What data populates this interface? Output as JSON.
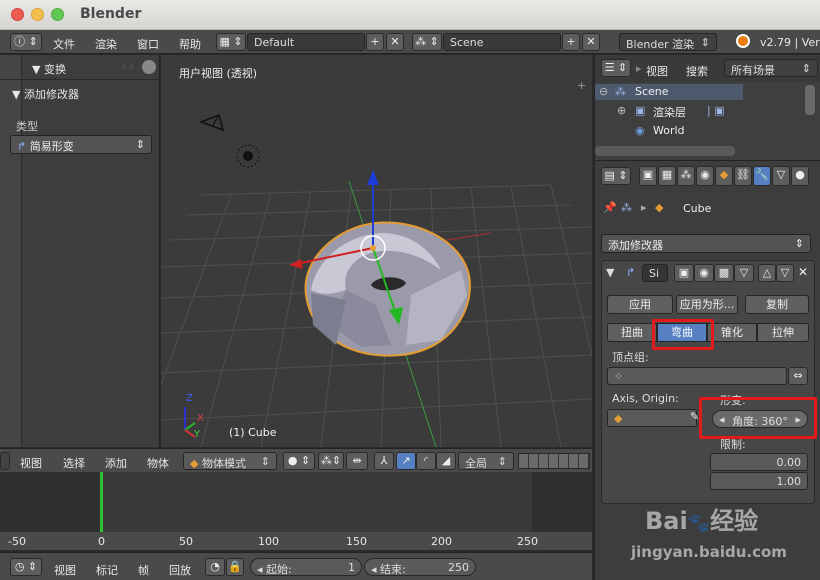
{
  "window": {
    "title": "Blender"
  },
  "topbar": {
    "menus": [
      "文件",
      "渲染",
      "窗口",
      "帮助"
    ],
    "screen_layout": "Default",
    "scene": "Scene",
    "engine": "Blender 渲染",
    "version": "v2.79 | Ver"
  },
  "left_panel": {
    "transform_label": "▼ 变换",
    "add_modifier_label": "▼ 添加修改器",
    "type_label": "类型",
    "type_value": "简易形变"
  },
  "viewport": {
    "view_label": "用户视图 (透视)",
    "object_label": "(1) Cube",
    "axis_x": "X",
    "axis_y": "Y",
    "axis_z": "Z"
  },
  "outliner": {
    "menus": [
      "视图",
      "搜索"
    ],
    "filter": "所有场景",
    "tree": [
      "Scene",
      "渲染层",
      "World"
    ]
  },
  "properties": {
    "breadcrumb": "Cube",
    "add_modifier": "添加修改器",
    "modifier_name": "Si",
    "apply_label": "应用",
    "apply_shape_label": "应用为形...",
    "copy_label": "复制",
    "modes": [
      "扭曲",
      "弯曲",
      "锥化",
      "拉伸"
    ],
    "active_mode": "弯曲",
    "vertex_group_label": "顶点组:",
    "axis_origin_label": "Axis, Origin:",
    "deform_label": "形变:",
    "angle_label": "角度:",
    "angle_value": "360°",
    "limits_label": "限制:",
    "limit_min": "0.00",
    "limit_max": "1.00"
  },
  "viewport_header": {
    "menus": [
      "视图",
      "选择",
      "添加",
      "物体"
    ],
    "mode": "物体模式",
    "pivot": "全局"
  },
  "timeline": {
    "ruler_labels": [
      "-50",
      "0",
      "50",
      "100",
      "150",
      "200",
      "250"
    ],
    "menus": [
      "视图",
      "标记",
      "帧",
      "回放"
    ],
    "start_label": "起始:",
    "start_value": "1",
    "end_label": "结束:",
    "end_value": "250"
  },
  "watermark": {
    "brand": "Bai",
    "brand2": "经验",
    "url": "jingyan.baidu.com"
  },
  "colors": {
    "accent": "#5680c2",
    "highlight": "#e11b1b",
    "frame": "#30c030"
  }
}
